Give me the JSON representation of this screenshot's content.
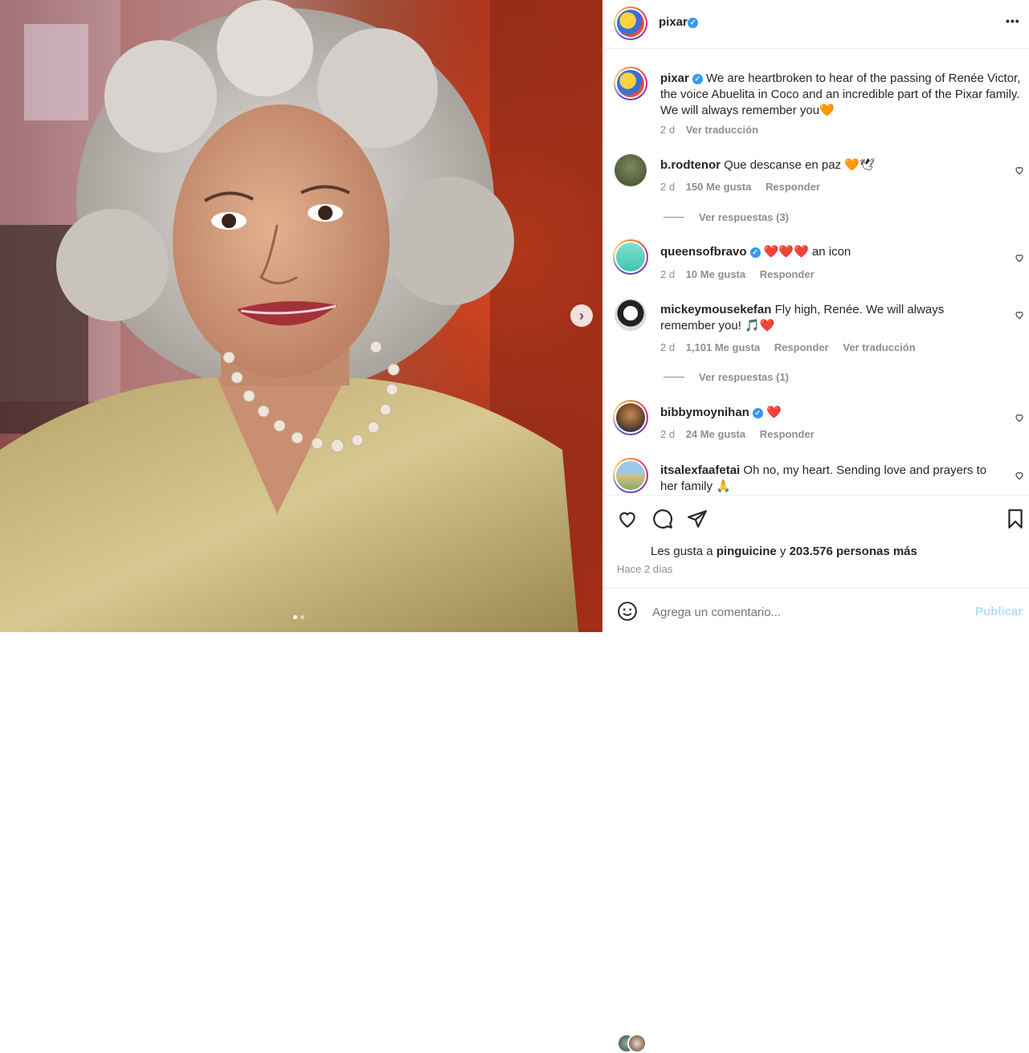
{
  "post": {
    "author": "pixar",
    "caption": "We are heartbroken to hear of the passing of Renée Victor, the voice Abuelita in Coco and an incredible part of the Pixar family. We will always remember you🧡",
    "age": "2 d",
    "translate": "Ver traducción"
  },
  "header": {
    "username": "pixar",
    "more": "•••"
  },
  "comments": [
    {
      "user": "b.rodtenor",
      "verified": false,
      "text": "Que descanse en paz 🧡🕊",
      "age": "2 d",
      "likes": "150 Me gusta",
      "reply": "Responder",
      "translate": "",
      "view_replies": "Ver respuestas (3)"
    },
    {
      "user": "queensofbravo",
      "verified": true,
      "text": "❤️❤️❤️ an icon",
      "age": "2 d",
      "likes": "10 Me gusta",
      "reply": "Responder",
      "translate": "",
      "view_replies": ""
    },
    {
      "user": "mickeymousekefan",
      "verified": false,
      "text_line1": "Fly high, Renée. We will always",
      "text_line2": "remember you! 🎵❤️",
      "age": "2 d",
      "likes": "1,101 Me gusta",
      "reply": "Responder",
      "translate": "Ver traducción",
      "view_replies": "Ver respuestas (1)"
    },
    {
      "user": "bibbymoynihan",
      "verified": true,
      "text": "❤️",
      "age": "2 d",
      "likes": "24 Me gusta",
      "reply": "Responder",
      "translate": "",
      "view_replies": ""
    },
    {
      "user": "itsalexfaafetai",
      "verified": false,
      "text_line1": "Oh no, my heart. Sending love and prayers to",
      "text_line2": "her family 🙏"
    }
  ],
  "likes": {
    "prefix": "Les gusta a",
    "user": "pinguicine",
    "joiner": "y",
    "count": "203.576 personas más"
  },
  "posted": "Hace 2 días",
  "composer": {
    "placeholder": "Agrega un comentario...",
    "publish": "Publicar"
  },
  "icons": {
    "like": "heart-outline-icon",
    "comment": "comment-bubble-icon",
    "share": "paper-plane-icon",
    "save": "bookmark-icon",
    "emoji": "smiley-icon",
    "next": "chevron-right-icon",
    "verified": "verified-badge-icon"
  },
  "colors": {
    "verified": "#3897f0",
    "muted": "#8e8e8e",
    "publish_disabled": "#b2dffc"
  }
}
